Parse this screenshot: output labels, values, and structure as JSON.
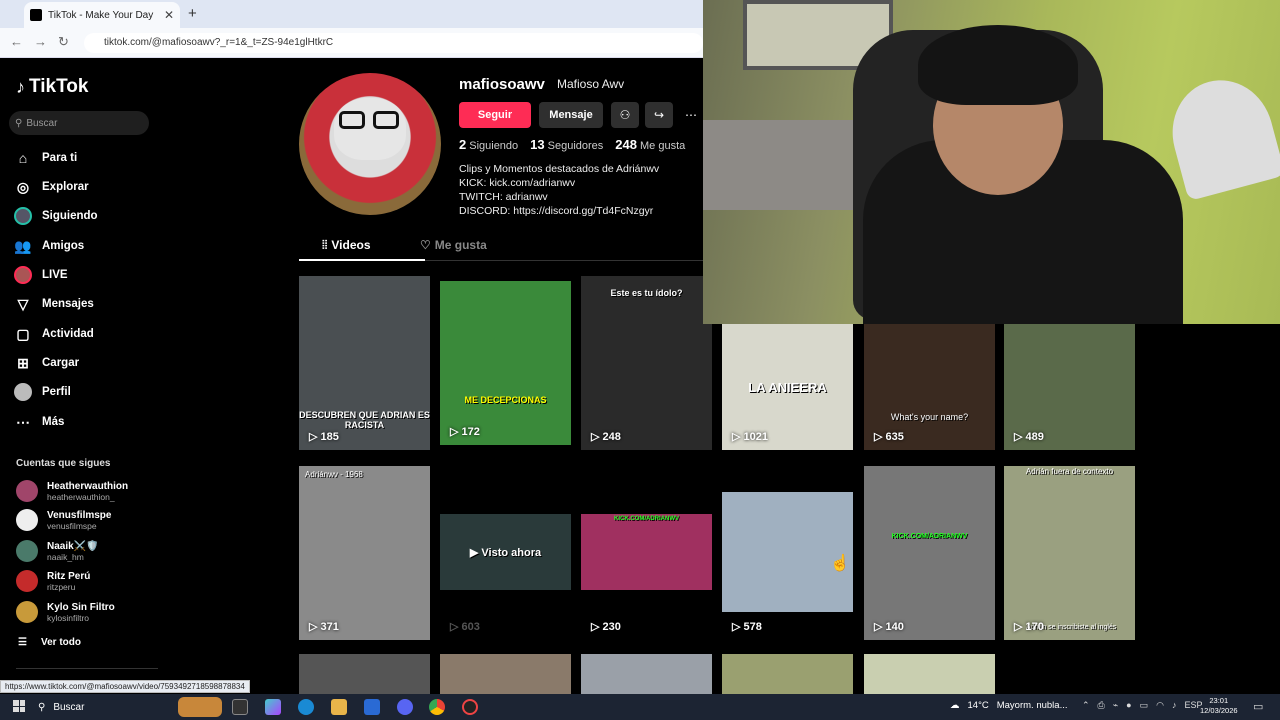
{
  "browser": {
    "tab_title": "TikTok - Make Your Day",
    "url": "tiktok.com/@mafiosoawv?_r=1&_t=ZS-94e1glHtkrC",
    "status_url": "https://www.tiktok.com/@mafiosoawv/video/7593492718598878834"
  },
  "sidebar": {
    "logo": "TikTok",
    "search_placeholder": "Buscar",
    "nav": [
      {
        "label": "Para ti",
        "icon": "home-icon"
      },
      {
        "label": "Explorar",
        "icon": "compass-icon"
      },
      {
        "label": "Siguiendo",
        "icon": "following-avatar-icon"
      },
      {
        "label": "Amigos",
        "icon": "friends-icon"
      },
      {
        "label": "LIVE",
        "icon": "live-icon"
      },
      {
        "label": "Mensajes",
        "icon": "messages-icon"
      },
      {
        "label": "Actividad",
        "icon": "activity-icon"
      },
      {
        "label": "Cargar",
        "icon": "upload-icon"
      },
      {
        "label": "Perfil",
        "icon": "profile-icon"
      },
      {
        "label": "Más",
        "icon": "more-icon"
      }
    ],
    "following_title": "Cuentas que sigues",
    "following": [
      {
        "name": "Heatherwauthion",
        "handle": "heatherwauthion_",
        "color": "#a0456a"
      },
      {
        "name": "Venusfilmspe",
        "handle": "venusfilmspe",
        "color": "#eeeeee"
      },
      {
        "name": "Naaik⚔️🛡️",
        "handle": "naaik_hm",
        "color": "#4a7a6a"
      },
      {
        "name": "Ritz Perú",
        "handle": "ritzperu",
        "color": "#c42b2b"
      },
      {
        "name": "Kylo Sin Filtro",
        "handle": "kylosinfiltro",
        "color": "#c89a3a"
      }
    ],
    "see_all": "Ver todo"
  },
  "profile": {
    "username": "mafiosoawv",
    "display_name": "Mafioso Awv",
    "follow_button": "Seguir",
    "message_button": "Mensaje",
    "stats": {
      "following_count": "2",
      "following_label": "Siguiendo",
      "followers_count": "13",
      "followers_label": "Seguidores",
      "likes_count": "248",
      "likes_label": "Me gusta"
    },
    "bio": [
      "Clips y Momentos destacados de Adriánwv",
      "KICK: kick.com/adrianwv",
      "TWITCH: adrianwv",
      "DISCORD: https://discord.gg/Td4FcNzgyr"
    ],
    "tabs": {
      "videos": "Videos",
      "likes": "Me gusta"
    }
  },
  "videos": [
    {
      "views": "185",
      "caption": "DESCUBREN QUE ADRIAN ES RACISTA",
      "color": "#4a4f52"
    },
    {
      "views": "172",
      "caption": "ME DECEPCIONAS",
      "color": "#3a8a3a"
    },
    {
      "views": "248",
      "caption": "Este es tu ídolo?",
      "color": "#2a2a2a"
    },
    {
      "views": "1021",
      "caption": "LA ANIEERA",
      "color": "#d8d8cc"
    },
    {
      "views": "635",
      "caption": "What's your name?",
      "color": "#3a2a20"
    },
    {
      "views": "489",
      "caption": "",
      "color": "#5a6a4a"
    },
    {
      "views": "371",
      "caption": "Adriánwv - 1968",
      "color": "#8a8a8a"
    },
    {
      "views": "603",
      "caption": "Visto ahora",
      "color": "#1a1a1a"
    },
    {
      "views": "230",
      "caption": "KICK.COM/ADRIANWV",
      "color": "#a03060"
    },
    {
      "views": "578",
      "caption": "",
      "color": "#a0b0c0"
    },
    {
      "views": "140",
      "caption": "KICK.COM/ADRIANWV",
      "color": "#777777"
    },
    {
      "views": "170",
      "caption": "Adrián fuera de contexto",
      "color": "#9aa080"
    }
  ],
  "video_extra_caption": "Adrián se inscribiste al inglés",
  "taskbar": {
    "search": "Buscar",
    "weather": "14°C",
    "weather_text": "Mayorm. nubla...",
    "lang": "ESP",
    "time": "23:01",
    "date": "12/03/2026"
  }
}
